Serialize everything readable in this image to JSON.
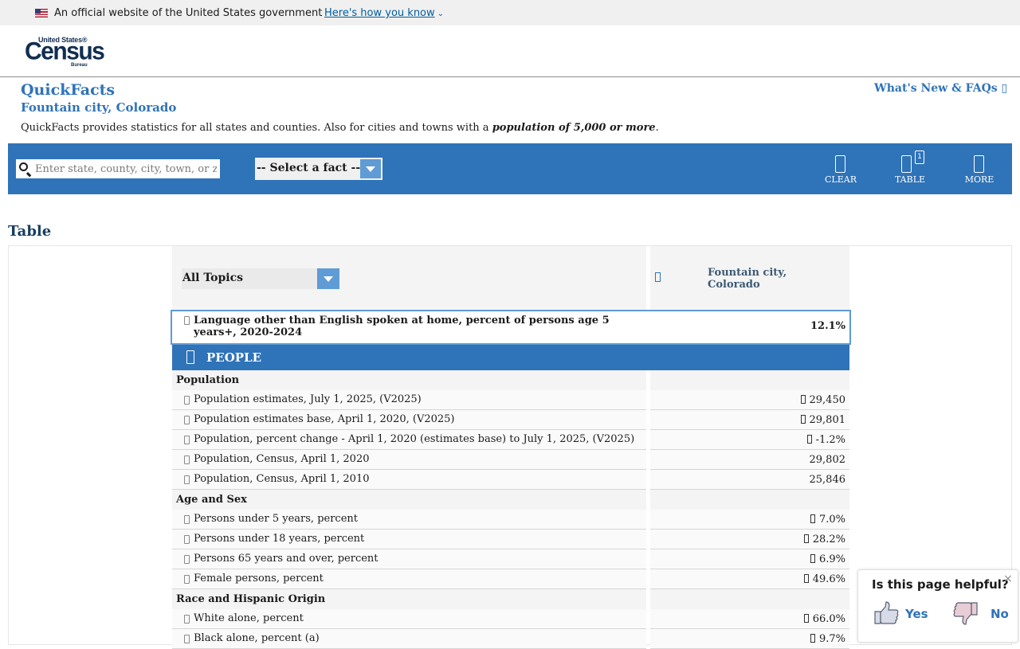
{
  "gov_banner": {
    "text": "An official website of the United States government",
    "link": "Here's how you know"
  },
  "logo": {
    "line1": "United States®",
    "line2": "Census",
    "line3": "Bureau"
  },
  "header": {
    "title": "QuickFacts",
    "subtitle": "Fountain city, Colorado",
    "description": "QuickFacts provides statistics for all states and counties. Also for cities and towns with a ",
    "description_emphasis": "population of 5,000 or more",
    "description_end": ".",
    "whats_new": "What's New & FAQs ▯"
  },
  "toolbar": {
    "search_placeholder": "Enter state, county, city, town, or zip code",
    "fact_select": "-- Select a fact --",
    "clear_label": "CLEAR",
    "table_label": "TABLE",
    "table_badge": "1",
    "more_label": "MORE"
  },
  "table_heading": "Table",
  "table": {
    "topic_select": "All Topics",
    "location": "Fountain city, Colorado",
    "highlight": {
      "label": "Language other than English spoken at home, percent of persons age 5 years+, 2020-2024",
      "value": "12.1%"
    },
    "people_label": "PEOPLE",
    "sections": [
      {
        "title": "Population",
        "rows": [
          {
            "label": "Population estimates, July 1, 2025, (V2025)",
            "value": "29,450",
            "note": true
          },
          {
            "label": "Population estimates base, April 1, 2020, (V2025)",
            "value": "29,801",
            "note": true
          },
          {
            "label": "Population, percent change - April 1, 2020 (estimates base) to July 1, 2025, (V2025)",
            "value": "-1.2%",
            "note": true
          },
          {
            "label": "Population, Census, April 1, 2020",
            "value": "29,802",
            "note": false
          },
          {
            "label": "Population, Census, April 1, 2010",
            "value": "25,846",
            "note": false
          }
        ]
      },
      {
        "title": "Age and Sex",
        "rows": [
          {
            "label": "Persons under 5 years, percent",
            "value": "7.0%",
            "note": true
          },
          {
            "label": "Persons under 18 years, percent",
            "value": "28.2%",
            "note": true
          },
          {
            "label": "Persons 65 years and over, percent",
            "value": "6.9%",
            "note": true
          },
          {
            "label": "Female persons, percent",
            "value": "49.6%",
            "note": true
          }
        ]
      },
      {
        "title": "Race and Hispanic Origin",
        "rows": [
          {
            "label": "White alone, percent",
            "value": "66.0%",
            "note": true
          },
          {
            "label": "Black alone, percent (a)",
            "value": "9.7%",
            "note": true
          }
        ]
      }
    ]
  },
  "feedback": {
    "question": "Is this page helpful?",
    "close": "×",
    "yes": "Yes",
    "no": "No"
  },
  "colors": {
    "brand_blue": "#2f73b8",
    "select_arrow": "#5f9bd4",
    "heading_dark": "#163e5f"
  }
}
